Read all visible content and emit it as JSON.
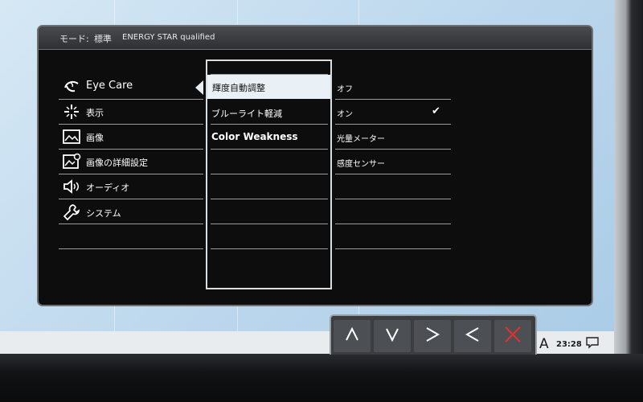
{
  "osd": {
    "header": {
      "mode_label": "モード:",
      "mode_value": "標準",
      "energy_star": "ENERGY STAR qualified"
    },
    "main_menu": [
      {
        "label": "Eye Care",
        "icon": "eye-care-icon",
        "selected": true
      },
      {
        "label": "表示",
        "icon": "display-icon"
      },
      {
        "label": "画像",
        "icon": "picture-icon"
      },
      {
        "label": "画像の詳細設定",
        "icon": "advanced-picture-icon"
      },
      {
        "label": "オーディオ",
        "icon": "speaker-icon"
      },
      {
        "label": "システム",
        "icon": "wrench-icon"
      }
    ],
    "submenu": [
      {
        "label": "輝度自動調整",
        "highlighted": true
      },
      {
        "label": "ブルーライト軽減"
      },
      {
        "label": "Color Weakness",
        "bold": true
      }
    ],
    "options": [
      {
        "label": "オフ"
      },
      {
        "label": "オン",
        "checked": true
      },
      {
        "label": "光量メーター"
      },
      {
        "label": "感度センサー"
      }
    ]
  },
  "navigation_buttons": [
    {
      "icon": "up-arrow-icon",
      "glyph": "∧"
    },
    {
      "icon": "down-arrow-icon",
      "glyph": "∨"
    },
    {
      "icon": "right-arrow-icon",
      "glyph": ">"
    },
    {
      "icon": "left-arrow-icon",
      "glyph": "<"
    },
    {
      "icon": "close-icon",
      "glyph": "✕",
      "color": "#e0322f"
    }
  ],
  "taskbar": {
    "ime_indicator": "A",
    "clock": "23:28"
  },
  "colors": {
    "highlight": "#eaf1f6",
    "close_red": "#e0322f"
  }
}
